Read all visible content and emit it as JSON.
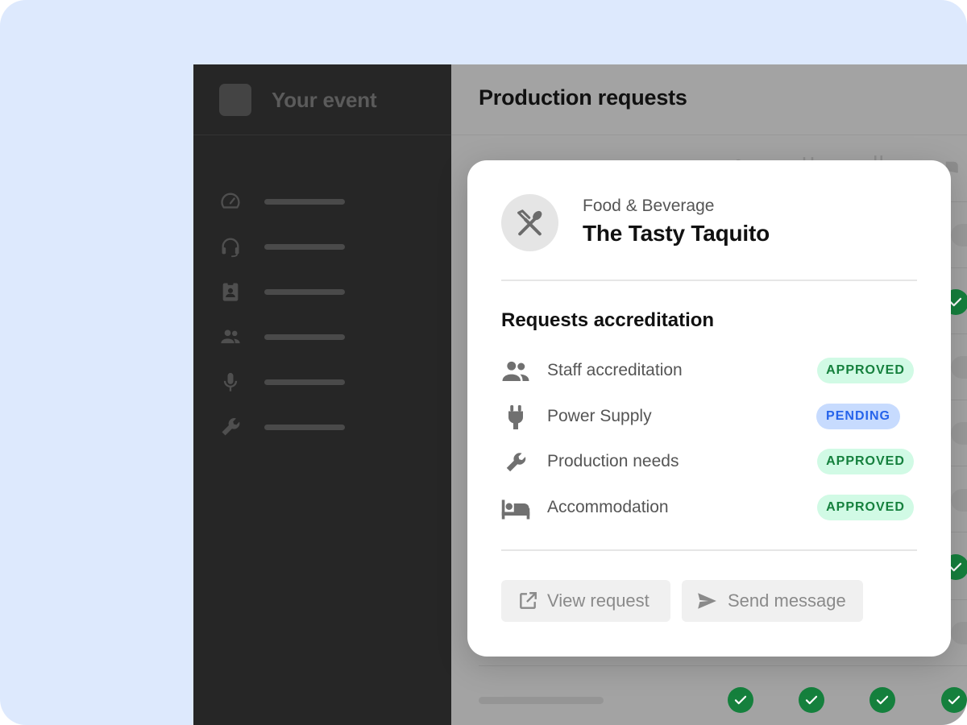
{
  "app": {
    "event_name": "Your event"
  },
  "main": {
    "page_title": "Production requests"
  },
  "modal": {
    "vendor_category": "Food & Beverage",
    "vendor_name": "The Tasty Taquito",
    "section_title": "Requests accreditation",
    "requests": [
      {
        "label": "Staff accreditation",
        "status": "APPROVED",
        "icon": "people-icon"
      },
      {
        "label": "Power Supply",
        "status": "PENDING",
        "icon": "plug-icon"
      },
      {
        "label": "Production needs",
        "status": "APPROVED",
        "icon": "wrench-icon"
      },
      {
        "label": "Accommodation",
        "status": "APPROVED",
        "icon": "bed-icon"
      }
    ],
    "view_request_label": "View request",
    "send_message_label": "Send message"
  },
  "colors": {
    "approved_bg": "#d1fae5",
    "approved_text": "#15803d",
    "pending_bg": "#c7dbfe",
    "pending_text": "#2563eb",
    "sidebar_bg": "#262626",
    "frame_bg": "#dde9fd"
  }
}
